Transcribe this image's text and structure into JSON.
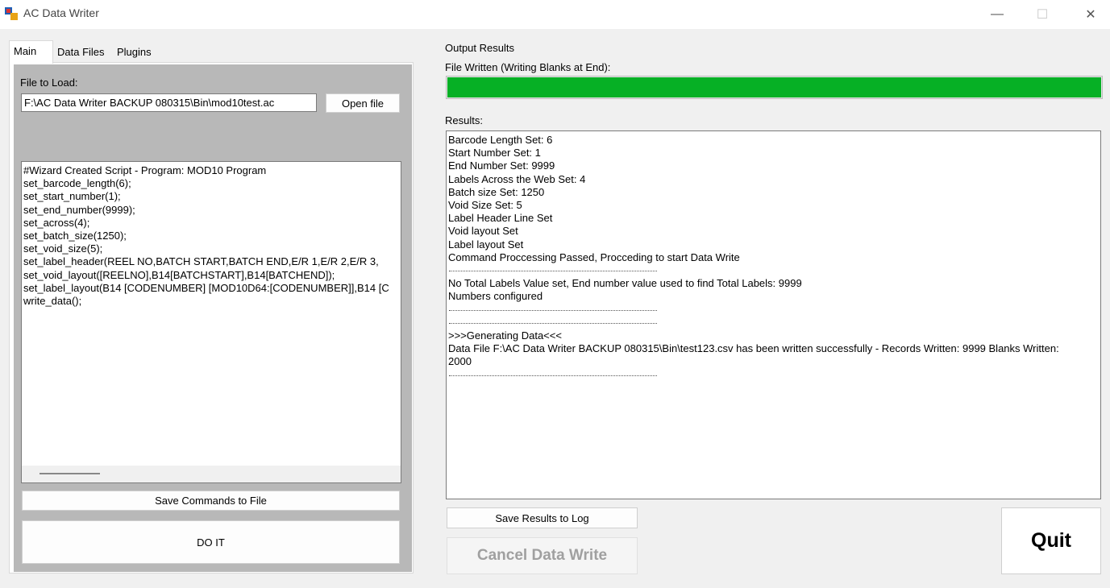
{
  "window": {
    "title": "AC Data Writer",
    "icon": "app-icon",
    "controls": {
      "minimize": "—",
      "maximize": "☐",
      "close": "✕"
    }
  },
  "tabs": [
    {
      "label": "Main",
      "selected": true
    },
    {
      "label": "Data Files",
      "selected": false
    },
    {
      "label": "Plugins",
      "selected": false
    }
  ],
  "main": {
    "file_label": "File to Load:",
    "file_value": "F:\\AC Data Writer BACKUP 080315\\Bin\\mod10test.ac",
    "open_button": "Open file",
    "script_lines": [
      "#Wizard Created Script - Program: MOD10 Program",
      "set_barcode_length(6);",
      "set_start_number(1);",
      "set_end_number(9999);",
      "set_across(4);",
      "set_batch_size(1250);",
      "set_void_size(5);",
      "set_label_header(REEL NO,BATCH START,BATCH END,E/R 1,E/R 2,E/R 3,",
      "set_void_layout([REELNO],B14[BATCHSTART],B14[BATCHEND]);",
      "set_label_layout(B14 [CODENUMBER] [MOD10D64:[CODENUMBER]],B14 [C",
      "write_data();"
    ],
    "save_commands_button": "Save Commands to File",
    "do_it_button": "DO IT"
  },
  "output": {
    "section_label": "Output Results",
    "progress_label": "File Written (Writing Blanks at End):",
    "progress_fraction": 1.0,
    "progress_color": "#06b025",
    "results_label": "Results:",
    "results_lines": [
      "Barcode Length Set: 6",
      "Start Number Set: 1",
      "End Number Set: 9999",
      "Labels Across the Web Set: 4",
      "Batch size Set: 1250",
      "Void Size Set: 5",
      "Label Header Line Set",
      "Void layout Set",
      "Label layout Set",
      "Command Proccessing Passed, Procceding to start Data Write",
      "",
      "No Total Labels Value set, End number value used to find Total Labels: 9999",
      "Numbers configured",
      "",
      "",
      ">>>Generating Data<<<",
      "Data File F:\\AC Data Writer BACKUP 080315\\Bin\\test123.csv has been written successfully - Records Written: 9999 Blanks Written:",
      "2000",
      ""
    ],
    "save_log_button": "Save Results to Log",
    "cancel_button": "Cancel Data Write",
    "quit_button": "Quit"
  }
}
